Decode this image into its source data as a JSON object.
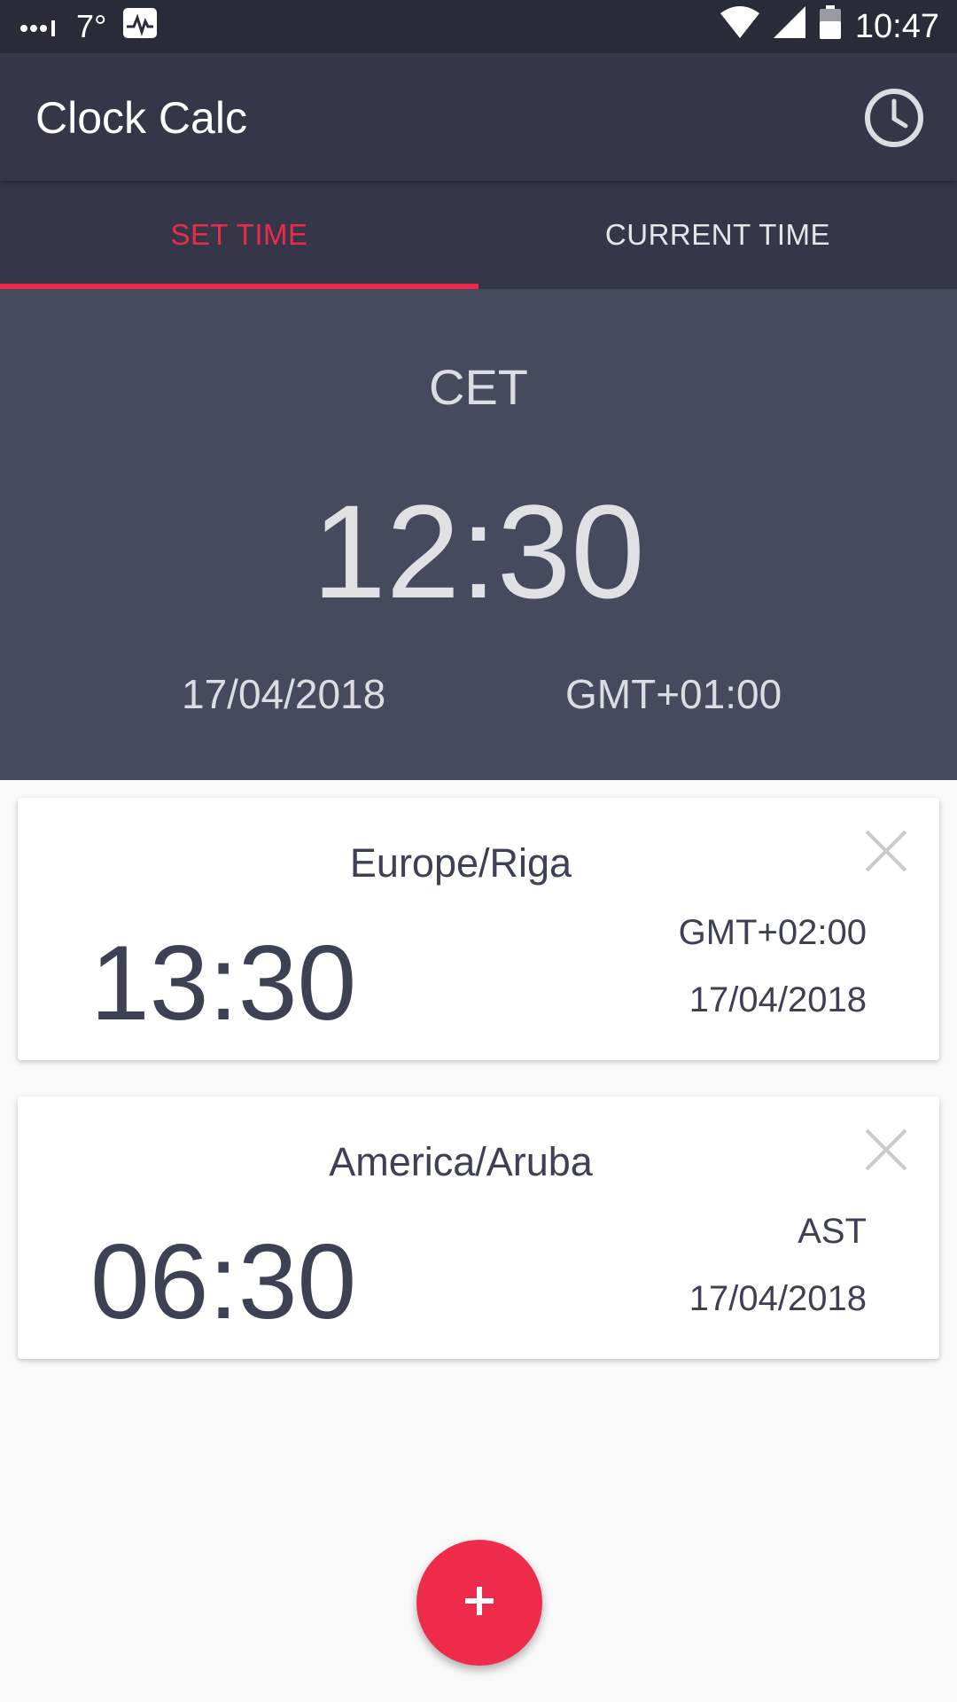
{
  "status_bar": {
    "temperature": "7°",
    "time": "10:47",
    "icons": [
      "signal-dots-icon",
      "activity-icon",
      "wifi-icon",
      "cell-signal-icon",
      "battery-icon"
    ]
  },
  "app_bar": {
    "title": "Clock Calc",
    "history_icon": "clock-icon"
  },
  "tabs": [
    {
      "label": "SET TIME",
      "active": true
    },
    {
      "label": "CURRENT TIME",
      "active": false
    }
  ],
  "main": {
    "zone": "CET",
    "time": "12:30",
    "date": "17/04/2018",
    "offset": "GMT+01:00"
  },
  "cards": [
    {
      "zone": "Europe/Riga",
      "time": "13:30",
      "offset": "GMT+02:00",
      "date": "17/04/2018"
    },
    {
      "zone": "America/Aruba",
      "time": "06:30",
      "offset": "AST",
      "date": "17/04/2018"
    }
  ],
  "fab": {
    "label": "+",
    "icon": "plus-icon"
  },
  "colors": {
    "accent": "#ec2a4b",
    "app_bar": "#353748",
    "panel": "#474a5c",
    "text_dark": "#3e4053"
  }
}
